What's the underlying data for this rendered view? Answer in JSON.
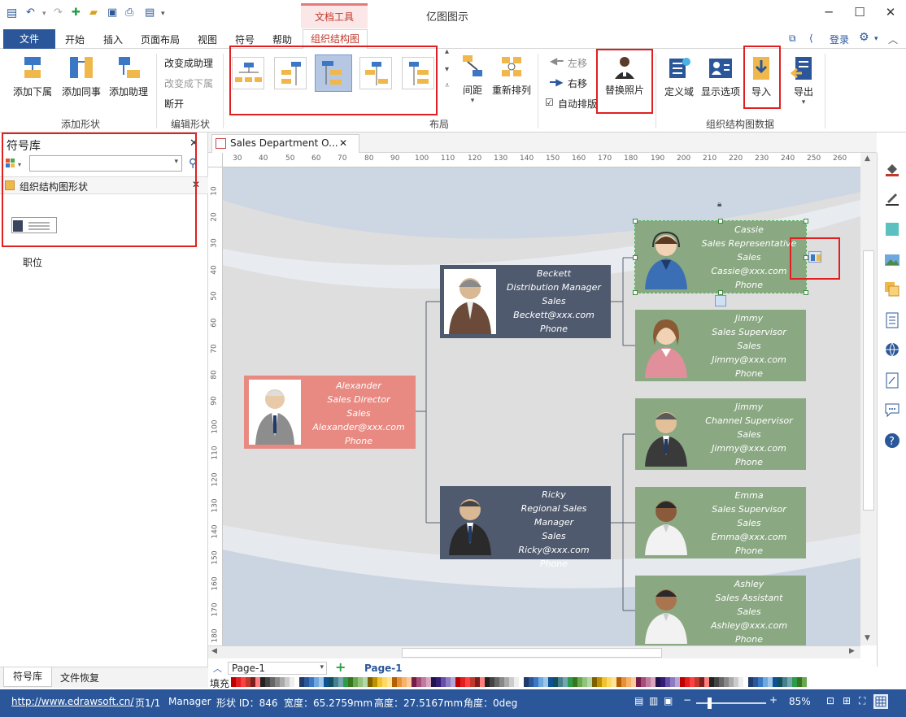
{
  "window": {
    "doc_tools_tab": "文档工具",
    "app_title": "亿图图示",
    "login": "登录"
  },
  "menu": {
    "file": "文件",
    "items": [
      "开始",
      "插入",
      "页面布局",
      "视图",
      "符号",
      "帮助"
    ],
    "org_tab": "组织结构图"
  },
  "ribbon": {
    "add_group": {
      "label": "添加形状",
      "buttons": [
        "添加下属",
        "添加同事",
        "添加助理"
      ]
    },
    "edit_group": {
      "label": "编辑形状",
      "items": [
        "改变成助理",
        "改变成下属",
        "断开"
      ]
    },
    "layout_group": {
      "label": "布局",
      "buttons": [
        "间距",
        "重新排列"
      ]
    },
    "move": {
      "left": "左移",
      "right": "右移",
      "auto": "自动排版"
    },
    "replace_photo": "替换照片",
    "data_group": {
      "label": "组织结构图数据",
      "buttons": [
        "定义域",
        "显示选项",
        "导入",
        "导出"
      ]
    }
  },
  "left_panel": {
    "title": "符号库",
    "library": "组织结构图形状",
    "shape_label": "职位",
    "bottom_tabs": [
      "符号库",
      "文件恢复"
    ]
  },
  "document": {
    "tab_title": "Sales Department O...",
    "page_selector": "Page-1",
    "page_tab": "Page-1",
    "fill_label": "填充"
  },
  "ruler": {
    "h": [
      "30",
      "40",
      "50",
      "60",
      "70",
      "80",
      "90",
      "100",
      "110",
      "120",
      "130",
      "140",
      "150",
      "160",
      "170",
      "180",
      "190",
      "200",
      "210",
      "220",
      "230",
      "240",
      "250",
      "260"
    ],
    "v": [
      "10",
      "20",
      "30",
      "40",
      "50",
      "60",
      "70",
      "80",
      "90",
      "100",
      "110",
      "120",
      "130",
      "140",
      "150",
      "160",
      "170",
      "180"
    ]
  },
  "org": {
    "alexander": {
      "name": "Alexander",
      "title": "Sales Director",
      "dept": "Sales",
      "email": "Alexander@xxx.com",
      "phone": "Phone"
    },
    "beckett": {
      "name": "Beckett",
      "title": "Distribution Manager",
      "dept": "Sales",
      "email": "Beckett@xxx.com",
      "phone": "Phone"
    },
    "ricky": {
      "name": "Ricky",
      "title": "Regional Sales Manager",
      "dept": "Sales",
      "email": "Ricky@xxx.com",
      "phone": "Phone"
    },
    "cassie": {
      "name": "Cassie",
      "title": "Sales Representative",
      "dept": "Sales",
      "email": "Cassie@xxx.com",
      "phone": "Phone"
    },
    "jimmy1": {
      "name": "Jimmy",
      "title": "Sales Supervisor",
      "dept": "Sales",
      "email": "Jimmy@xxx.com",
      "phone": "Phone"
    },
    "jimmy2": {
      "name": "Jimmy",
      "title": "Channel Supervisor",
      "dept": "Sales",
      "email": "Jimmy@xxx.com",
      "phone": "Phone"
    },
    "emma": {
      "name": "Emma",
      "title": "Sales Supervisor",
      "dept": "Sales",
      "email": "Emma@xxx.com",
      "phone": "Phone"
    },
    "ashley": {
      "name": "Ashley",
      "title": "Sales Assistant",
      "dept": "Sales",
      "email": "Ashley@xxx.com",
      "phone": "Phone"
    }
  },
  "status": {
    "url": "http://www.edrawsoft.cn/",
    "page": "页1/1",
    "shape": "Manager",
    "id": "形状 ID：846",
    "width": "宽度：65.2759mm",
    "height": "高度：27.5167mm",
    "angle": "角度：0deg",
    "zoom": "85%"
  },
  "colors": {
    "ribbon_blue": "#2b579a",
    "director_card": "#e88a82",
    "manager_card": "#4f5a6e",
    "staff_card": "#8aa882",
    "highlight": "#e02020"
  }
}
